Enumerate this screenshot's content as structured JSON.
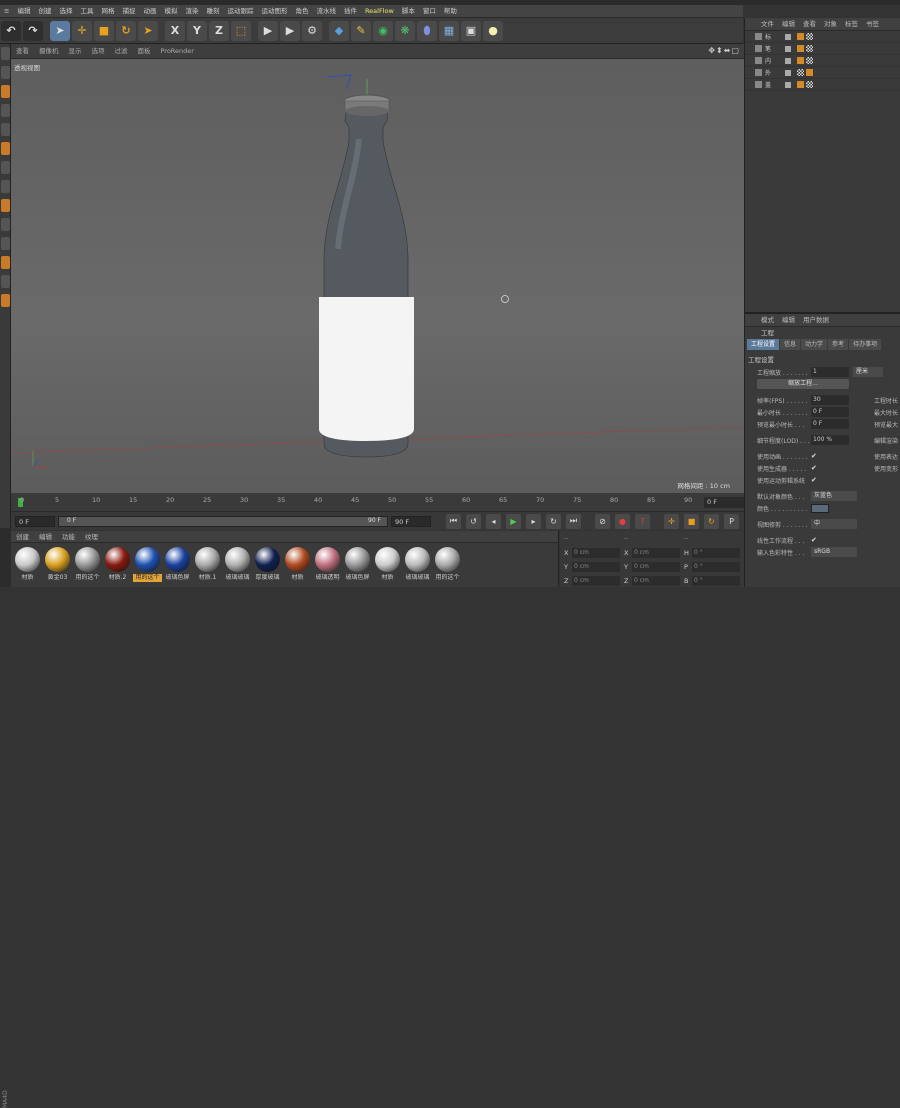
{
  "menu": [
    "≡",
    "编辑",
    "创建",
    "选择",
    "工具",
    "网格",
    "捕捉",
    "动画",
    "模拟",
    "渲染",
    "雕刻",
    "运动跟踪",
    "运动图形",
    "角色",
    "流水线",
    "插件",
    "RealFlow",
    "脚本",
    "窗口",
    "帮助"
  ],
  "toolbar": {
    "x_label": "X",
    "y_label": "Y",
    "z_label": "Z"
  },
  "viewport": {
    "menu": [
      "查看",
      "摄像机",
      "显示",
      "选项",
      "过滤",
      "面板",
      "ProRender"
    ],
    "label": "透视视图",
    "grid_spacing": "网格间距 : 10 cm"
  },
  "timeline": {
    "ticks": [
      "0",
      "5",
      "10",
      "15",
      "20",
      "25",
      "30",
      "35",
      "40",
      "45",
      "50",
      "55",
      "60",
      "65",
      "70",
      "75",
      "80",
      "85",
      "90"
    ],
    "current_frame": "0 F"
  },
  "playback": {
    "start_field": "0 F",
    "slider_start": "0 F",
    "slider_end": "90 F",
    "end_field": "90 F"
  },
  "materials": {
    "menu": [
      "创建",
      "编辑",
      "功能",
      "纹理"
    ],
    "items": [
      {
        "label": "材质",
        "color": "#c8c8c8"
      },
      {
        "label": "黄金03",
        "color": "#d9a020"
      },
      {
        "label": "用的这个",
        "color": "#999"
      },
      {
        "label": "材质.2",
        "color": "#8a1a10"
      },
      {
        "label": "用的这个",
        "color": "#1e50b0",
        "selected": true
      },
      {
        "label": "玻璃色屏",
        "color": "#1a40a0"
      },
      {
        "label": "材质.1",
        "color": "#aaa"
      },
      {
        "label": "玻璃玻璃",
        "color": "#b0b0b0"
      },
      {
        "label": "厚度玻璃",
        "color": "#102050"
      },
      {
        "label": "材质",
        "color": "#b04a20"
      },
      {
        "label": "玻璃透明",
        "color": "#c07080"
      },
      {
        "label": "玻璃色屏",
        "color": "#999"
      },
      {
        "label": "材质",
        "color": "#ccc"
      },
      {
        "label": "玻璃玻璃",
        "color": "#bbb"
      },
      {
        "label": "用的这个",
        "color": "#aaa"
      }
    ]
  },
  "coords": {
    "headers": [
      "--",
      "--",
      "--"
    ],
    "rows": [
      {
        "a": "X",
        "av": "0 cm",
        "b": "X",
        "bv": "0 cm",
        "c": "H",
        "cv": "0 °"
      },
      {
        "a": "Y",
        "av": "0 cm",
        "b": "Y",
        "bv": "0 cm",
        "c": "P",
        "cv": "0 °"
      },
      {
        "a": "Z",
        "av": "0 cm",
        "b": "Z",
        "bv": "0 cm",
        "c": "B",
        "cv": "0 °"
      }
    ]
  },
  "objects": {
    "menu": [
      "文件",
      "编辑",
      "查看",
      "对象",
      "标签",
      "书签"
    ],
    "rows": [
      "标",
      "笔",
      "内",
      "外",
      "盖"
    ]
  },
  "attributes": {
    "menu": [
      "模式",
      "编辑",
      "用户数据"
    ],
    "title": "工程",
    "tabs": [
      "工程设置",
      "信息",
      "动力学",
      "参考",
      "待办事项"
    ],
    "section": "工程设置",
    "scale_label": "工程缩放 . . . . . . .",
    "scale_value": "1",
    "scale_unit": "厘米",
    "scale_button": "缩放工程...",
    "fps_label": "帧率(FPS) . . . . . .",
    "fps_value": "30",
    "project_time": "工程时长",
    "min_time_label": "最小时长 . . . . . . .",
    "min_time_value": "0 F",
    "max_time": "最大时长",
    "preview_min_label": "预览最小时长 . . .",
    "preview_min_value": "0 F",
    "preview_max": "预览最大",
    "lod_label": "细节程度(LOD) . . .",
    "lod_value": "100 %",
    "render_lod": "编辑渲染",
    "use_anim_label": "使用动画 . . . . . . .",
    "use_expr": "使用表达",
    "use_gen_label": "使用生成器 . . . . .",
    "use_deform": "使用变形",
    "use_motion_label": "使用运动剪辑系统",
    "default_color_label": "默认对象颜色 . . .",
    "default_color_value": "灰蓝色",
    "color_label": "颜色 . . . . . . . . . .",
    "view_clip_label": "视图修剪 . . . . . . .",
    "view_clip_value": "中",
    "linear_label": "线性工作流程 . . .",
    "input_color_label": "输入色彩特性 . . .",
    "input_color_value": "sRGB"
  }
}
